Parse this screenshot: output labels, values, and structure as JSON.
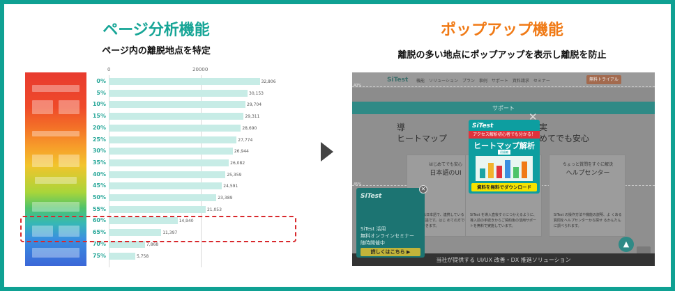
{
  "left": {
    "title": "ページ分析機能",
    "subtitle": "ページ内の離脱地点を特定"
  },
  "right": {
    "title": "ポップアップ機能",
    "subtitle": "離脱の多い地点にポップアップを表示し離脱を防止"
  },
  "colors": {
    "frame": "#0fa193",
    "teal": "#16a596",
    "orange": "#f07a16",
    "dash": "#d8282c"
  },
  "chart_data": {
    "type": "bar",
    "orientation": "horizontal",
    "categories": [
      "0%",
      "5%",
      "10%",
      "15%",
      "20%",
      "25%",
      "30%",
      "35%",
      "40%",
      "45%",
      "50%",
      "55%",
      "60%",
      "65%",
      "70%",
      "75%"
    ],
    "values": [
      32806,
      30153,
      29704,
      29311,
      28690,
      27774,
      26944,
      26082,
      25359,
      24591,
      23389,
      21053,
      14940,
      11397,
      7868,
      5758
    ],
    "value_labels": [
      "32,806",
      "30,153",
      "29,704",
      "29,311",
      "28,690",
      "27,774",
      "26,944",
      "26,082",
      "25,359",
      "24,591",
      "23,389",
      "21,053",
      "14,940",
      "11,397",
      "7,868",
      "5,758"
    ],
    "x_ticks": [
      "0",
      "20000"
    ],
    "xlim": [
      0,
      40000
    ],
    "highlight_categories": [
      "60%",
      "65%"
    ]
  },
  "screenshot": {
    "logo": "SiTest",
    "nav": "機能　ソリューション　プラン　事例　サポート　資料請求　セミナー",
    "cta": "無料トライアル",
    "band": "サポート",
    "heading_left_1": "導",
    "heading_left_2": "ヒートマップ",
    "heading_right_1": "実",
    "heading_right_2": "めてでも安心",
    "cards": [
      {
        "top": "はじめてでも安心",
        "name": "日本語のUI",
        "text": "SiTest は日本語で、連携している\n機能もすべて日本語です。はじ\nめての方でも安心して利用できます。"
      },
      {
        "top": "",
        "name": "",
        "text": "SiTest を導入直後すぐにつかえるように、\n導入前の手続きからご契約後の活用サポー\nトを無料で実施しています。"
      },
      {
        "top": "ちょっと質問をすぐに解決",
        "name": "ヘルプセンター",
        "text": "SiTest の操作方法や機能の説明、よ\nくある質問をヘルプセンターから探せ\nるかんたんに調べられます。"
      }
    ],
    "pct_top": "40%",
    "pct_mid": "45%",
    "footer": "当社が提供する UI/UX 改善・DX 推進ソリューション",
    "popup": {
      "logo": "SiTest",
      "ribbon": "アクセス解析初心者でも分かる！",
      "title": "ヒートマップ解析",
      "tag": "初級編",
      "button": "資料を無料でダウンロード"
    },
    "small_popup": {
      "logo": "SiTest",
      "line1": "SiTest 活用",
      "line2": "無料オンラインセミナー",
      "line3": "随時開催中",
      "button": "詳しくはこちら ▶"
    }
  }
}
